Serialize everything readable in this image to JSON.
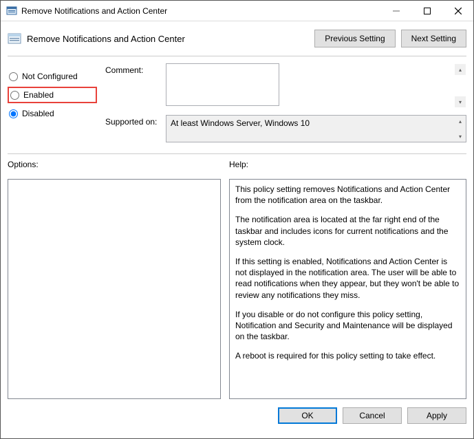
{
  "window": {
    "title": "Remove Notifications and Action Center"
  },
  "header": {
    "title": "Remove Notifications and Action Center"
  },
  "nav": {
    "previous": "Previous Setting",
    "next": "Next Setting"
  },
  "radios": {
    "not_configured": "Not Configured",
    "enabled": "Enabled",
    "disabled": "Disabled",
    "selected": "disabled"
  },
  "fields": {
    "comment_label": "Comment:",
    "comment_value": "",
    "supported_label": "Supported on:",
    "supported_value": "At least Windows Server, Windows 10"
  },
  "panels": {
    "options_label": "Options:",
    "help_label": "Help:",
    "help_text": {
      "p1": "This policy setting removes Notifications and Action Center from the notification area on the taskbar.",
      "p2": "The notification area is located at the far right end of the taskbar and includes icons for current notifications and the system clock.",
      "p3": "If this setting is enabled, Notifications and Action Center is not displayed in the notification area. The user will be able to read notifications when they appear, but they won't be able to review any notifications they miss.",
      "p4": "If you disable or do not configure this policy setting, Notification and Security and Maintenance will be displayed on the taskbar.",
      "p5": "A reboot is required for this policy setting to take effect."
    }
  },
  "buttons": {
    "ok": "OK",
    "cancel": "Cancel",
    "apply": "Apply"
  }
}
